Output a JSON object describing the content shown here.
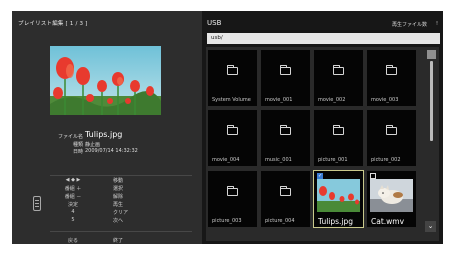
{
  "left": {
    "title": "プレイリスト編集 [ 1 / 3 ]",
    "info": {
      "file_label": "ファイル名",
      "file_value": "Tulips.jpg",
      "type_label": "種類",
      "type_value": "静止画",
      "date_label": "日時",
      "date_value": "2009/07/14 14:32:32"
    },
    "help": [
      {
        "key": "◀ ◆ ▶",
        "action": "移動"
      },
      {
        "key": "番組 ＋",
        "action": "選択"
      },
      {
        "key": "番組 －",
        "action": "解除"
      },
      {
        "key": "決定",
        "action": "再生"
      },
      {
        "key": "4",
        "action": "クリア"
      },
      {
        "key": "5",
        "action": "次へ"
      },
      {
        "key": "戻る",
        "action": "終了"
      }
    ]
  },
  "right": {
    "title": "USB",
    "save_file": "再生ファイル数",
    "bang": "!",
    "path": "usb/",
    "tiles": [
      {
        "name": "System Volume",
        "kind": "folder"
      },
      {
        "name": "movie_001",
        "kind": "folder"
      },
      {
        "name": "movie_002",
        "kind": "folder"
      },
      {
        "name": "movie_003",
        "kind": "folder"
      },
      {
        "name": "movie_004",
        "kind": "folder"
      },
      {
        "name": "music_001",
        "kind": "folder"
      },
      {
        "name": "picture_001",
        "kind": "folder"
      },
      {
        "name": "picture_002",
        "kind": "folder"
      },
      {
        "name": "picture_003",
        "kind": "folder"
      },
      {
        "name": "picture_004",
        "kind": "folder"
      },
      {
        "name": "Tulips.jpg",
        "kind": "image",
        "checked": true,
        "selected": true
      },
      {
        "name": "Cat.wmv",
        "kind": "video",
        "checked": false
      }
    ]
  }
}
